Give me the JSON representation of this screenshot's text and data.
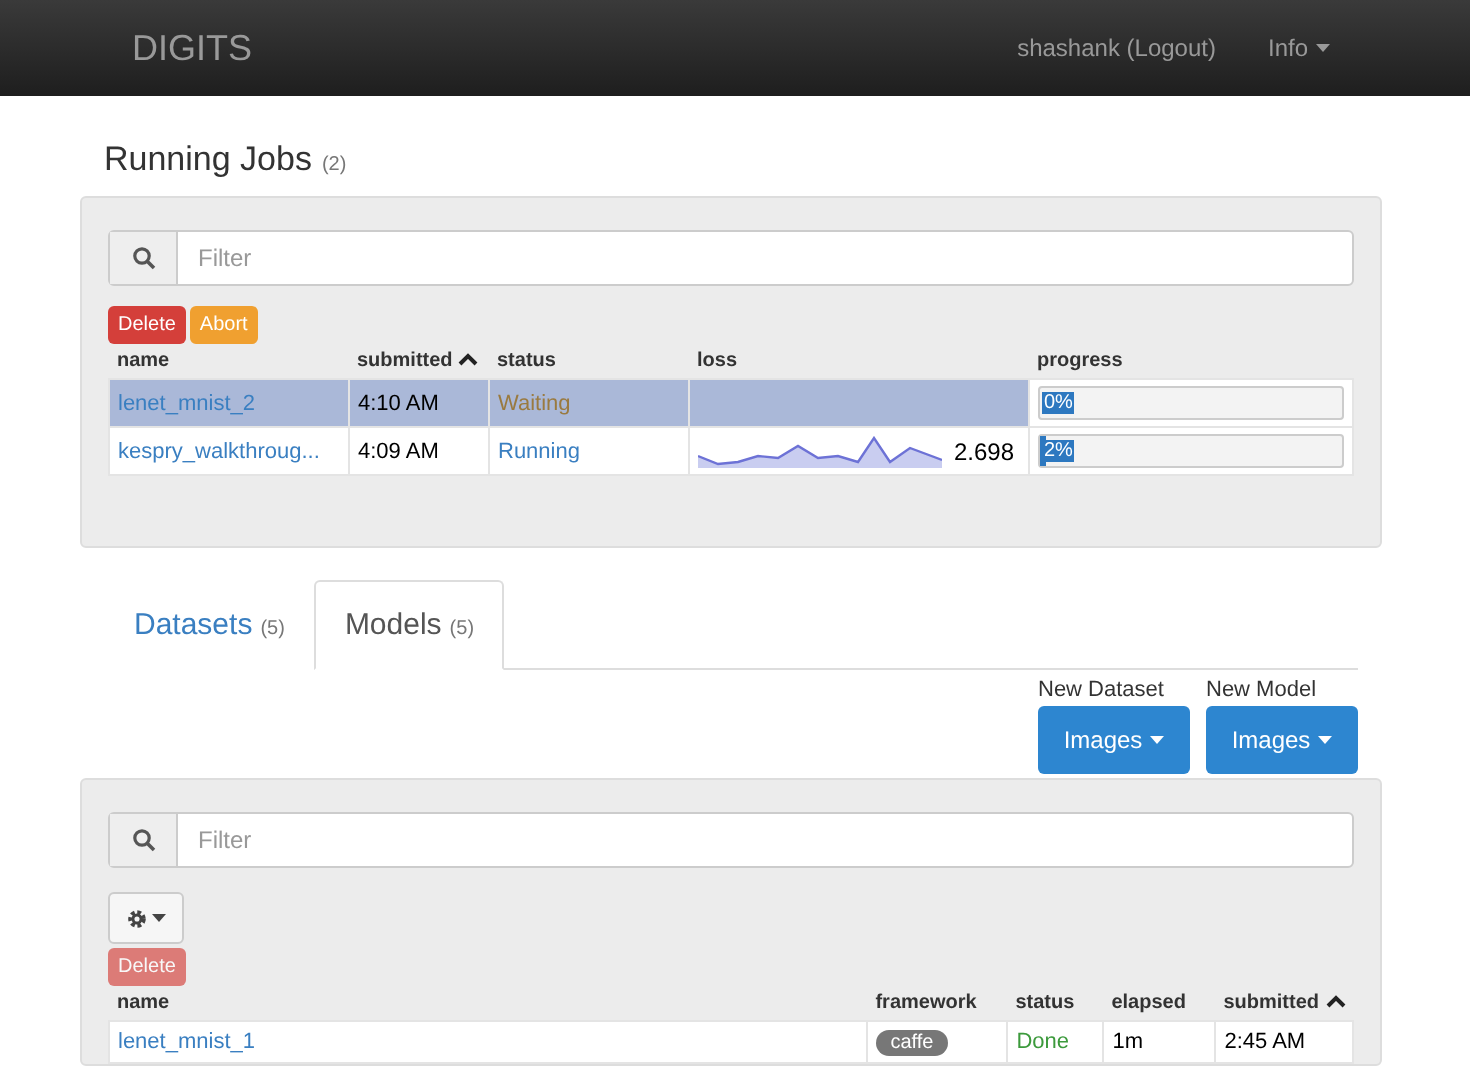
{
  "navbar": {
    "brand": "DIGITS",
    "user": "shashank (Logout)",
    "info": "Info"
  },
  "running_jobs": {
    "title": "Running Jobs",
    "count": "(2)",
    "filter": {
      "placeholder": "Filter"
    },
    "buttons": [
      {
        "label": "Delete",
        "kind": "danger"
      },
      {
        "label": "Abort",
        "kind": "warning"
      }
    ],
    "columns": [
      {
        "label": "name",
        "sorted": false
      },
      {
        "label": "submitted",
        "sorted": true
      },
      {
        "label": "status",
        "sorted": false
      },
      {
        "label": "loss",
        "sorted": false
      },
      {
        "label": "progress",
        "sorted": false
      }
    ],
    "rows": [
      {
        "name": "lenet_mnist_2",
        "submitted": "4:10 AM",
        "status": "Waiting",
        "color": "#9a7a40",
        "loss": "",
        "progress": "0%",
        "level": 0,
        "selected": true
      },
      {
        "name": "kespry_walkthroug...",
        "submitted": "4:09 AM",
        "status": "Running",
        "color": "#3a7fc1",
        "loss": "2.698",
        "progress": "2%",
        "level": 0.02,
        "selected": false
      }
    ]
  },
  "tabs": [
    {
      "label": "Datasets",
      "count": "(5)",
      "selected": false
    },
    {
      "label": "Models",
      "count": "(5)",
      "selected": true
    }
  ],
  "new_buttons": [
    {
      "caption": "New Dataset",
      "label": "Images"
    },
    {
      "caption": "New Model",
      "label": "Images"
    }
  ],
  "models": {
    "filter": {
      "placeholder": "Filter"
    },
    "delete": {
      "label": "Delete",
      "disabled": true
    },
    "columns": [
      {
        "label": "name",
        "sorted": false
      },
      {
        "label": "framework",
        "sorted": false
      },
      {
        "label": "status",
        "sorted": false
      },
      {
        "label": "elapsed",
        "sorted": false
      },
      {
        "label": "submitted",
        "sorted": true
      }
    ],
    "rows": [
      {
        "name": "lenet_mnist_1",
        "framework": "caffe",
        "status": "Done",
        "color": "#3c9a3c",
        "elapsed": "1m",
        "submitted": "2:45 AM"
      }
    ]
  }
}
